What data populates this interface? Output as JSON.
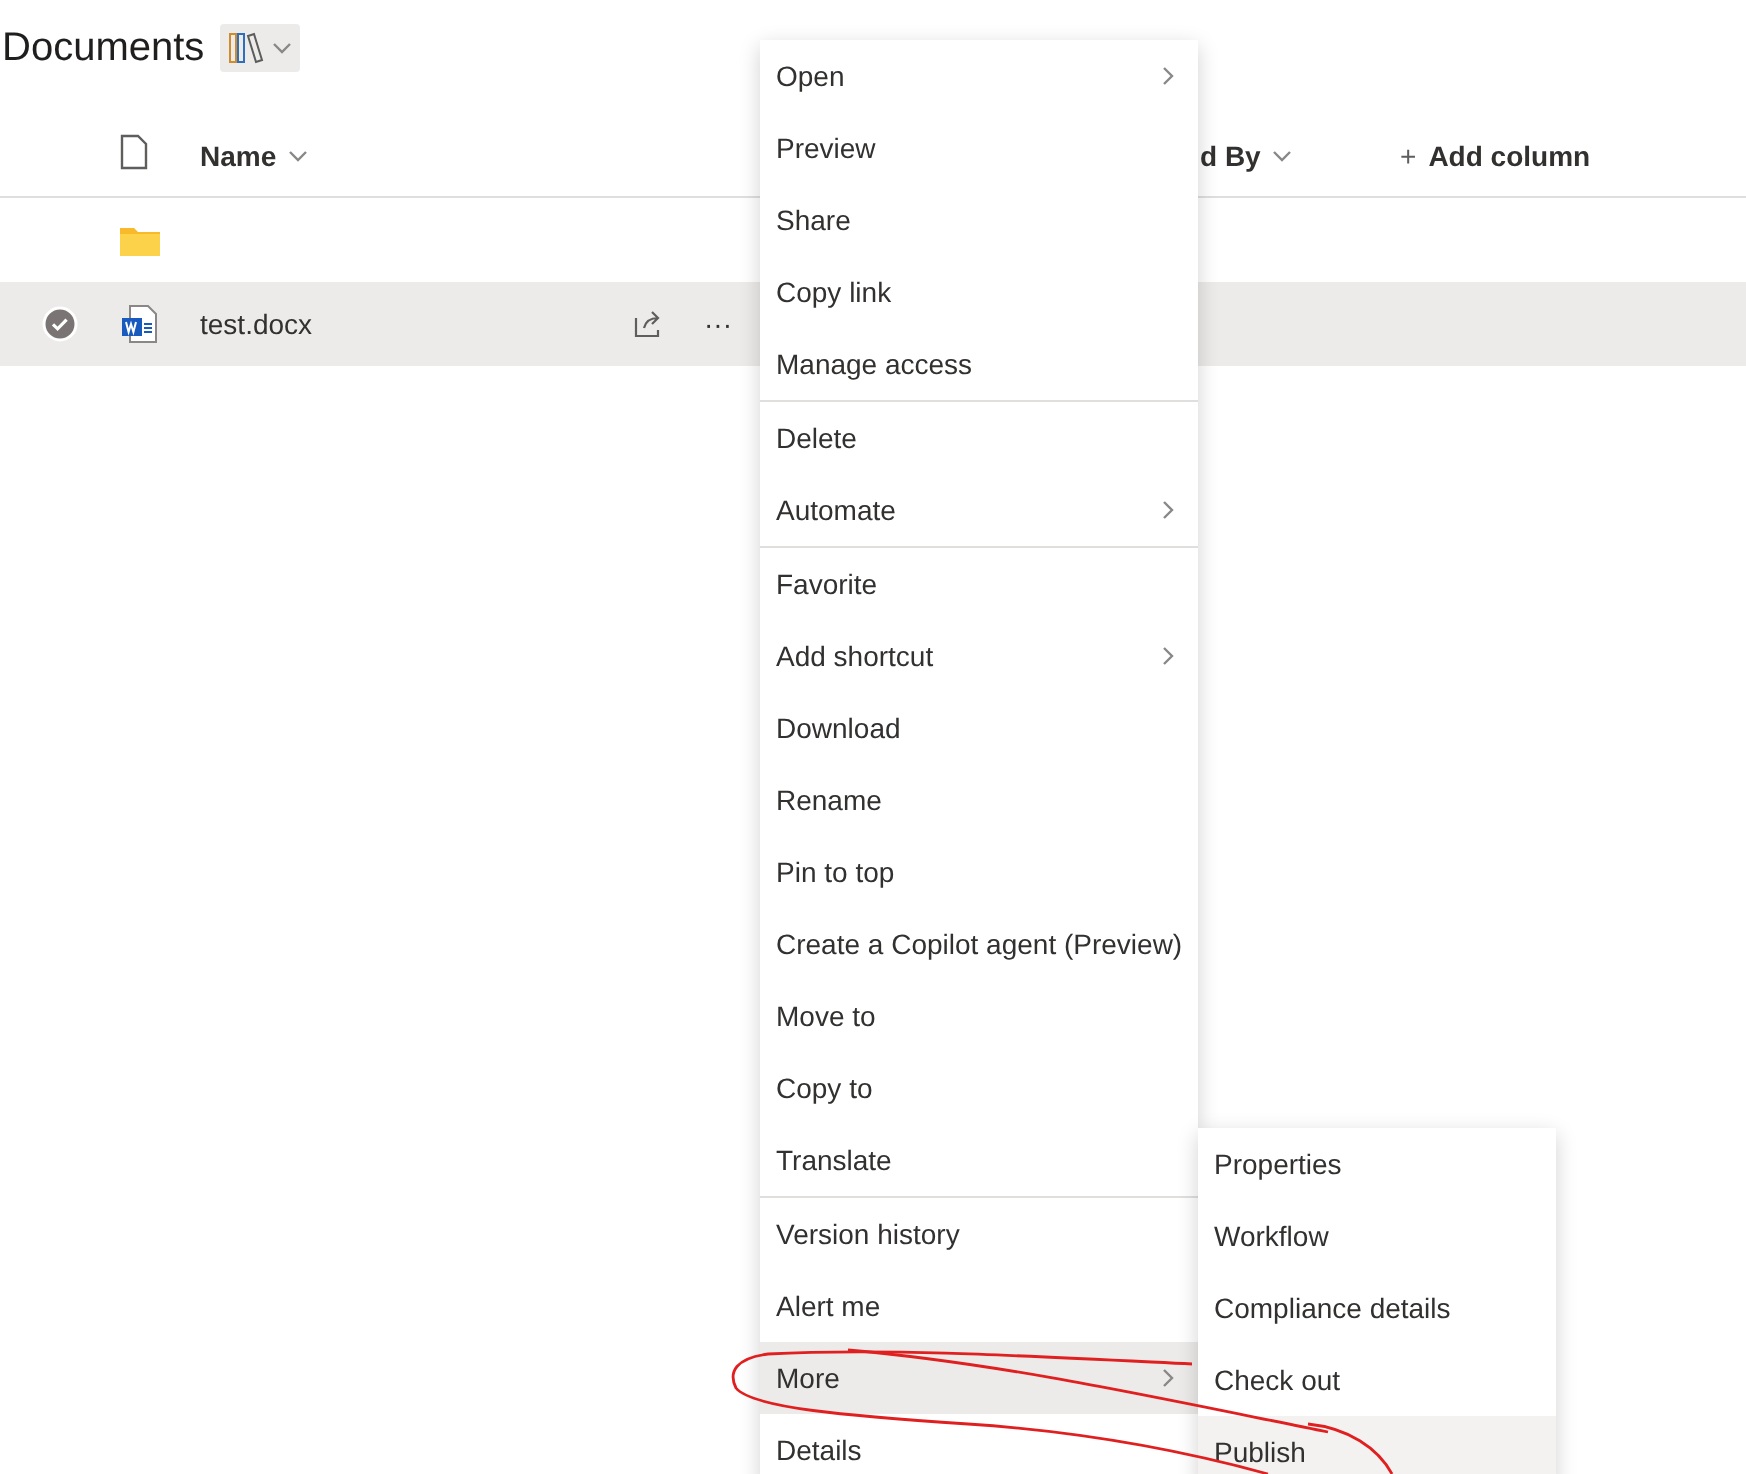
{
  "header": {
    "title": "Documents"
  },
  "columns": [
    {
      "kind": "type-icon"
    },
    {
      "kind": "sort",
      "label": "Name"
    },
    {
      "kind": "sort",
      "label": "d By"
    },
    {
      "kind": "add",
      "label": "Add column",
      "icon": "+"
    }
  ],
  "rows": [
    {
      "kind": "folder",
      "selected": false
    },
    {
      "kind": "document",
      "name": "test.docx",
      "selected": true,
      "more": "···"
    }
  ],
  "menu": {
    "groups": [
      [
        {
          "label": "Open",
          "submenu": true,
          "selected": false
        },
        {
          "label": "Preview",
          "submenu": false,
          "selected": false
        },
        {
          "label": "Share",
          "submenu": false,
          "selected": false
        },
        {
          "label": "Copy link",
          "submenu": false,
          "selected": false
        },
        {
          "label": "Manage access",
          "submenu": false,
          "selected": false
        }
      ],
      [
        {
          "label": "Delete",
          "submenu": false,
          "selected": false
        },
        {
          "label": "Automate",
          "submenu": true,
          "selected": false
        }
      ],
      [
        {
          "label": "Favorite",
          "submenu": false,
          "selected": false
        },
        {
          "label": "Add shortcut",
          "submenu": true,
          "selected": false
        },
        {
          "label": "Download",
          "submenu": false,
          "selected": false
        },
        {
          "label": "Rename",
          "submenu": false,
          "selected": false
        },
        {
          "label": "Pin to top",
          "submenu": false,
          "selected": false
        },
        {
          "label": "Create a Copilot agent (Preview)",
          "submenu": false,
          "selected": false
        },
        {
          "label": "Move to",
          "submenu": false,
          "selected": false
        },
        {
          "label": "Copy to",
          "submenu": false,
          "selected": false
        },
        {
          "label": "Translate",
          "submenu": false,
          "selected": false
        }
      ],
      [
        {
          "label": "Version history",
          "submenu": false,
          "selected": false
        },
        {
          "label": "Alert me",
          "submenu": false,
          "selected": false
        },
        {
          "label": "More",
          "submenu": true,
          "selected": true
        },
        {
          "label": "Details",
          "submenu": false,
          "selected": false
        }
      ]
    ]
  },
  "submenu": {
    "items": [
      {
        "label": "Properties",
        "selected": false
      },
      {
        "label": "Workflow",
        "selected": false
      },
      {
        "label": "Compliance details",
        "selected": false
      },
      {
        "label": "Check out",
        "selected": false
      },
      {
        "label": "Publish",
        "selected": true
      }
    ]
  }
}
